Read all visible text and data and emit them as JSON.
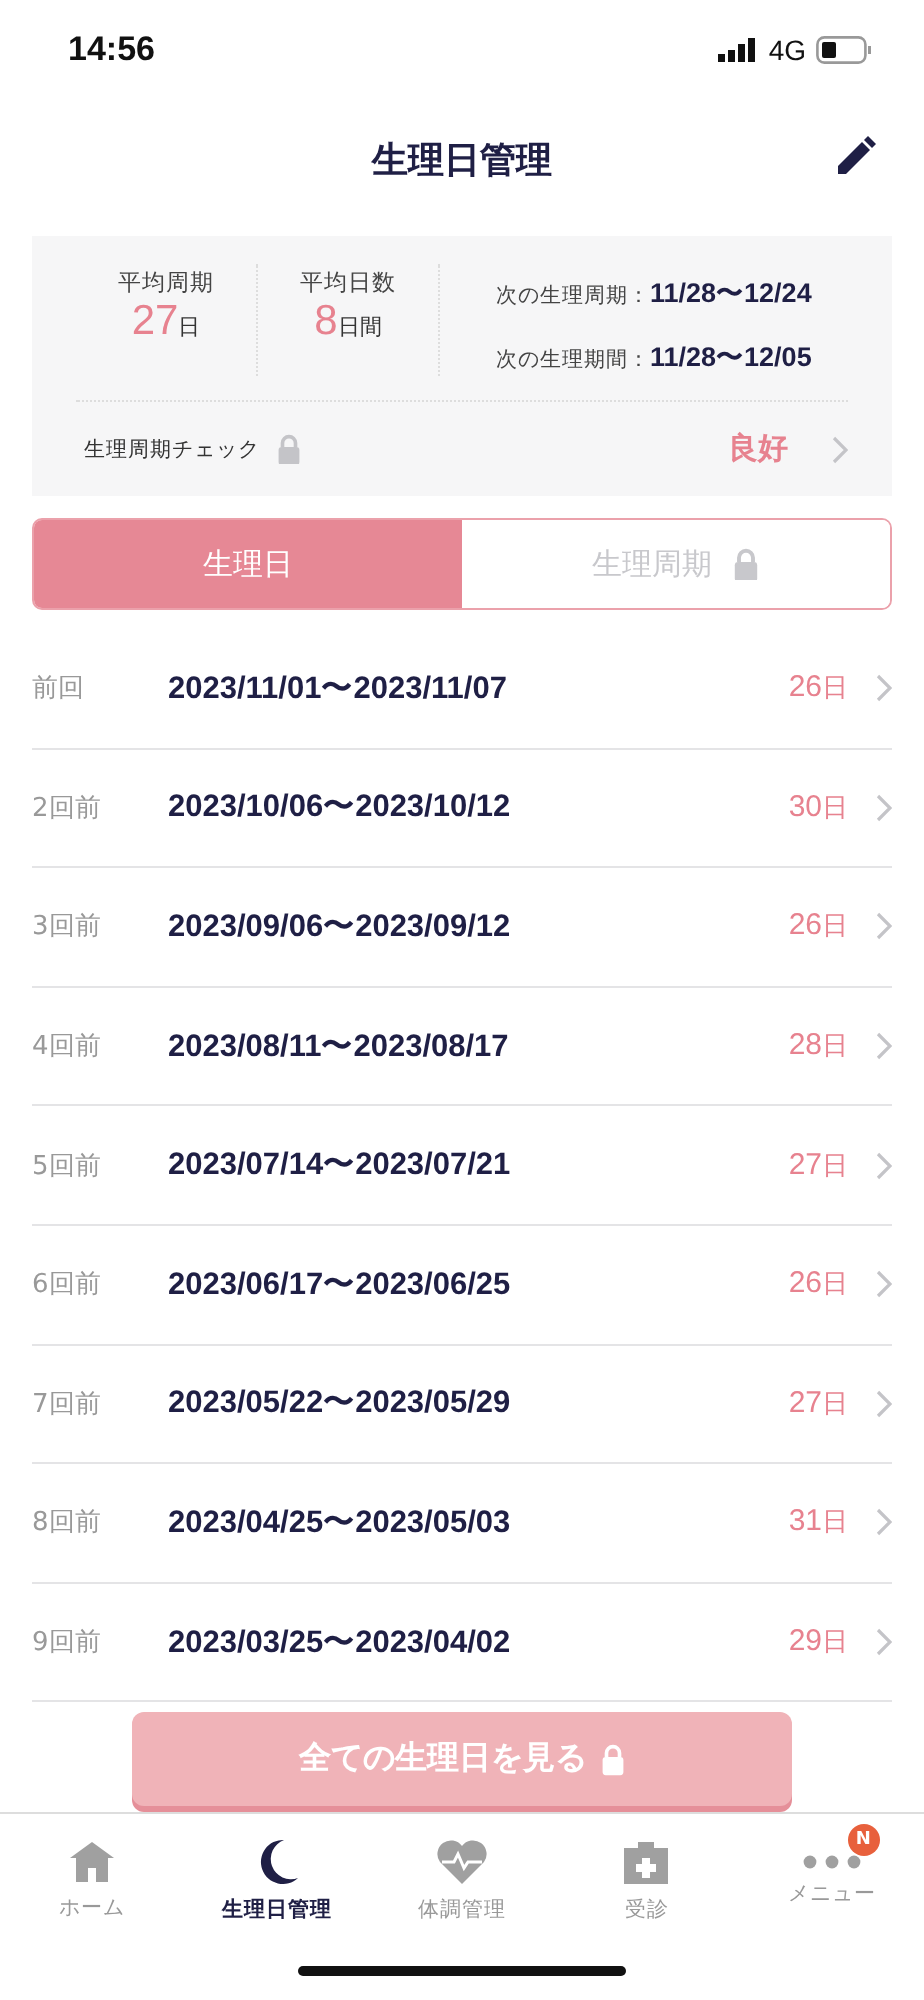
{
  "status_bar": {
    "time": "14:56",
    "network": "4G"
  },
  "header": {
    "title": "生理日管理"
  },
  "summary": {
    "avg_cycle": {
      "label": "平均周期",
      "value": "27",
      "unit": "日"
    },
    "avg_days": {
      "label": "平均日数",
      "value": "8",
      "unit": "日間"
    },
    "next": [
      {
        "label": "次の生理周期：",
        "value": "11/28〜12/24"
      },
      {
        "label": "次の生理期間：",
        "value": "11/28〜12/05"
      }
    ],
    "check": {
      "label": "生理周期チェック",
      "locked": true,
      "result": "良好"
    }
  },
  "tabs": [
    {
      "label": "生理日",
      "selected": true,
      "locked": false
    },
    {
      "label": "生理周期",
      "selected": false,
      "locked": true
    }
  ],
  "periods": [
    {
      "ago": "前回",
      "range": "2023/11/01〜2023/11/07",
      "days": "26",
      "unit": "日"
    },
    {
      "ago": "2回前",
      "range": "2023/10/06〜2023/10/12",
      "days": "30",
      "unit": "日"
    },
    {
      "ago": "3回前",
      "range": "2023/09/06〜2023/09/12",
      "days": "26",
      "unit": "日"
    },
    {
      "ago": "4回前",
      "range": "2023/08/11〜2023/08/17",
      "days": "28",
      "unit": "日"
    },
    {
      "ago": "5回前",
      "range": "2023/07/14〜2023/07/21",
      "days": "27",
      "unit": "日"
    },
    {
      "ago": "6回前",
      "range": "2023/06/17〜2023/06/25",
      "days": "26",
      "unit": "日"
    },
    {
      "ago": "7回前",
      "range": "2023/05/22〜2023/05/29",
      "days": "27",
      "unit": "日"
    },
    {
      "ago": "8回前",
      "range": "2023/04/25〜2023/05/03",
      "days": "31",
      "unit": "日"
    },
    {
      "ago": "9回前",
      "range": "2023/03/25〜2023/04/02",
      "days": "29",
      "unit": "日"
    }
  ],
  "view_all_button": {
    "label": "全ての生理日を見る",
    "locked": true
  },
  "nav": [
    {
      "kind": "home",
      "label": "ホーム",
      "selected": false
    },
    {
      "kind": "moon",
      "label": "生理日管理",
      "selected": true
    },
    {
      "kind": "heart",
      "label": "体調管理",
      "selected": false
    },
    {
      "kind": "clinic",
      "label": "受診",
      "selected": false
    },
    {
      "kind": "more",
      "label": "メニュー",
      "selected": false,
      "badge": "N"
    }
  ]
}
